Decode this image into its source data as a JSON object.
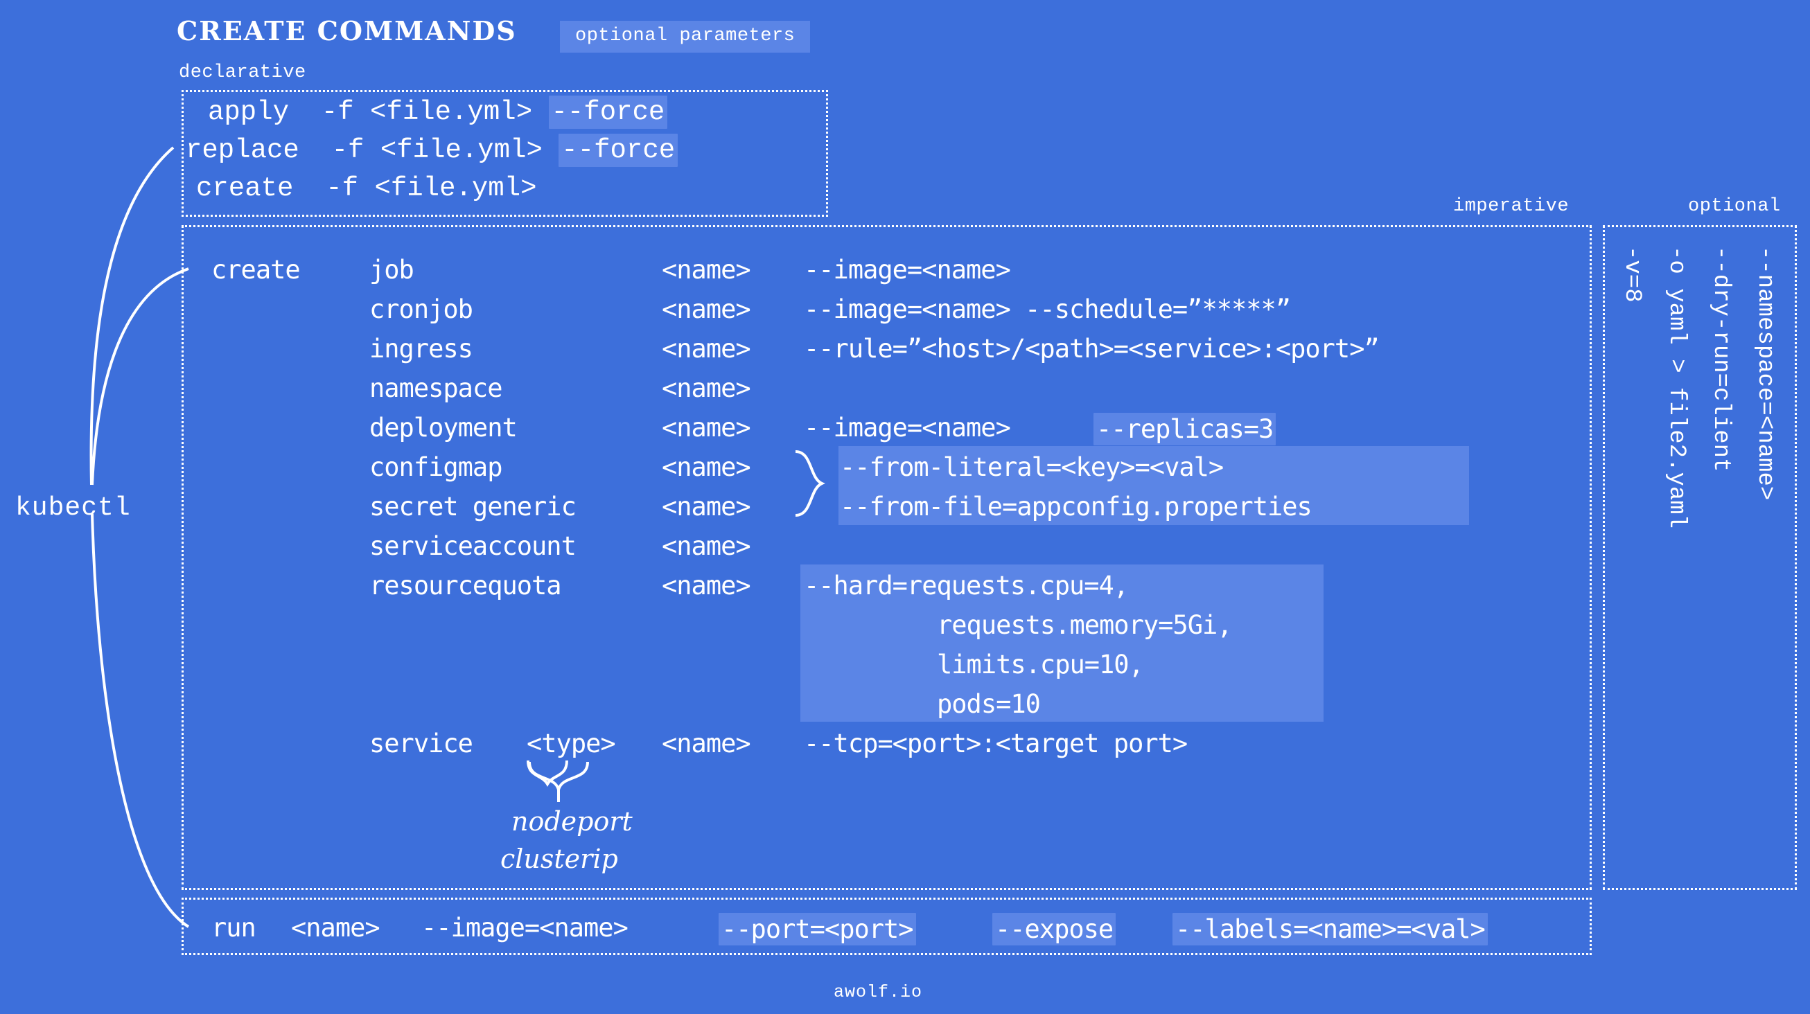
{
  "page": {
    "background_color": "#3d6fdb",
    "text_color": "#ffffff",
    "highlight_color": "#5b85e6",
    "title": "CREATE COMMANDS",
    "footer": "awolf.io"
  },
  "legend": {
    "optional_parameters": "optional parameters"
  },
  "root": {
    "label": "kubectl"
  },
  "sections": {
    "declarative_label": "declarative",
    "imperative_label": "imperative",
    "optional_label": "optional"
  },
  "declarative": {
    "rows": [
      {
        "verb": "apply",
        "args": "-f <file.yml>",
        "flag": "--force"
      },
      {
        "verb": "replace",
        "args": "-f <file.yml>",
        "flag": "--force"
      },
      {
        "verb": "create",
        "args": "-f <file.yml>",
        "flag": ""
      }
    ]
  },
  "imperative": {
    "verb": "create",
    "rows": [
      {
        "kind": "job",
        "name": "<name>",
        "args": "--image=<name>"
      },
      {
        "kind": "cronjob",
        "name": "<name>",
        "args": "--image=<name> --schedule=”*****”"
      },
      {
        "kind": "ingress",
        "name": "<name>",
        "args": "--rule=”<host>/<path>=<service>:<port>”"
      },
      {
        "kind": "namespace",
        "name": "<name>",
        "args": ""
      },
      {
        "kind": "deployment",
        "name": "<name>",
        "args": "--image=<name>",
        "flag": "--replicas=3"
      },
      {
        "kind": "configmap",
        "name": "<name>",
        "args": ""
      },
      {
        "kind": "secret generic",
        "name": "<name>",
        "args": ""
      },
      {
        "kind": "serviceaccount",
        "name": "<name>",
        "args": ""
      },
      {
        "kind": "resourcequota",
        "name": "<name>",
        "args": ""
      }
    ],
    "grouped_flags": [
      "--from-literal=<key>=<val>",
      "--from-file=appconfig.properties"
    ],
    "resourcequota_flag": [
      "--hard=requests.cpu=4,",
      "requests.memory=5Gi,",
      "limits.cpu=10,",
      "pods=10"
    ],
    "service_row": {
      "kind": "service",
      "type": "<type>",
      "name": "<name>",
      "args": "--tcp=<port>:<target port>",
      "type_options": [
        "nodeport",
        "clusterip"
      ]
    }
  },
  "run": {
    "verb": "run",
    "name": "<name>",
    "args": "--image=<name>",
    "flags": [
      "--port=<port>",
      "--expose",
      "--labels=<name>=<val>"
    ]
  },
  "optional_flags": [
    "--namespace=<name>",
    "--dry-run=client",
    "-o yaml > file2.yaml",
    "-v=8"
  ]
}
